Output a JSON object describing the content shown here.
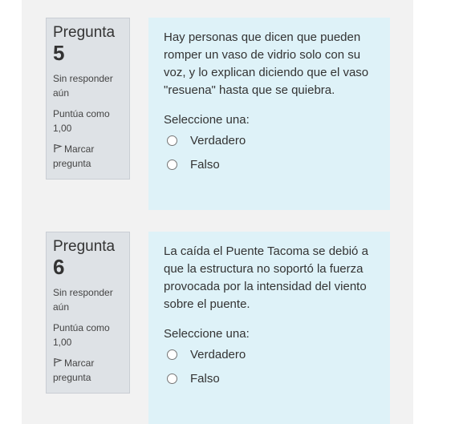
{
  "questions": [
    {
      "label": "Pregunta",
      "number": "5",
      "status": "Sin responder aún",
      "score": "Puntúa como 1,00",
      "flag": "Marcar pregunta",
      "text": "Hay personas que dicen que pueden romper un vaso de vidrio solo con su voz, y lo explican diciendo que el vaso \"resuena\" hasta que se quiebra.",
      "prompt": "Seleccione una:",
      "options": [
        "Verdadero",
        "Falso"
      ]
    },
    {
      "label": "Pregunta",
      "number": "6",
      "status": "Sin responder aún",
      "score": "Puntúa como 1,00",
      "flag": "Marcar pregunta",
      "text": "La caída el Puente Tacoma se debió a que la estructura no soportó la fuerza provocada por la intensidad del viento sobre el puente.",
      "prompt": "Seleccione una:",
      "options": [
        "Verdadero",
        "Falso"
      ]
    }
  ]
}
